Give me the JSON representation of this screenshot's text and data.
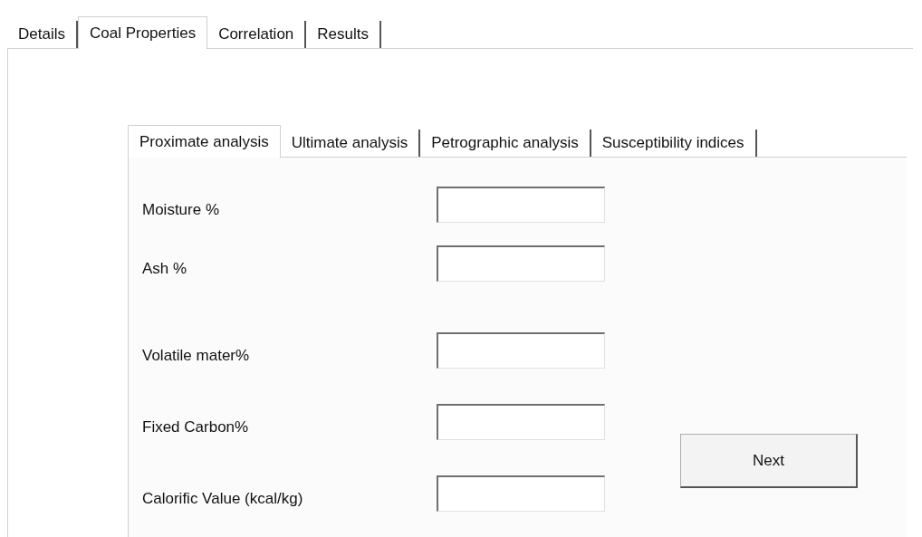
{
  "tabs": [
    {
      "label": "Details",
      "selected": false
    },
    {
      "label": "Coal Properties",
      "selected": true
    },
    {
      "label": "Correlation",
      "selected": false
    },
    {
      "label": "Results",
      "selected": false
    }
  ],
  "sub_tabs": [
    {
      "label": "Proximate analysis",
      "selected": true
    },
    {
      "label": "Ultimate analysis",
      "selected": false
    },
    {
      "label": "Petrographic analysis",
      "selected": false
    },
    {
      "label": "Susceptibility indices",
      "selected": false
    }
  ],
  "fields": [
    {
      "label": "Moisture %"
    },
    {
      "label": "Ash %"
    },
    {
      "label": "Volatile mater%"
    },
    {
      "label": "Fixed Carbon%"
    },
    {
      "label": "Calorific Value (kcal/kg)"
    }
  ],
  "next_button": "Next"
}
